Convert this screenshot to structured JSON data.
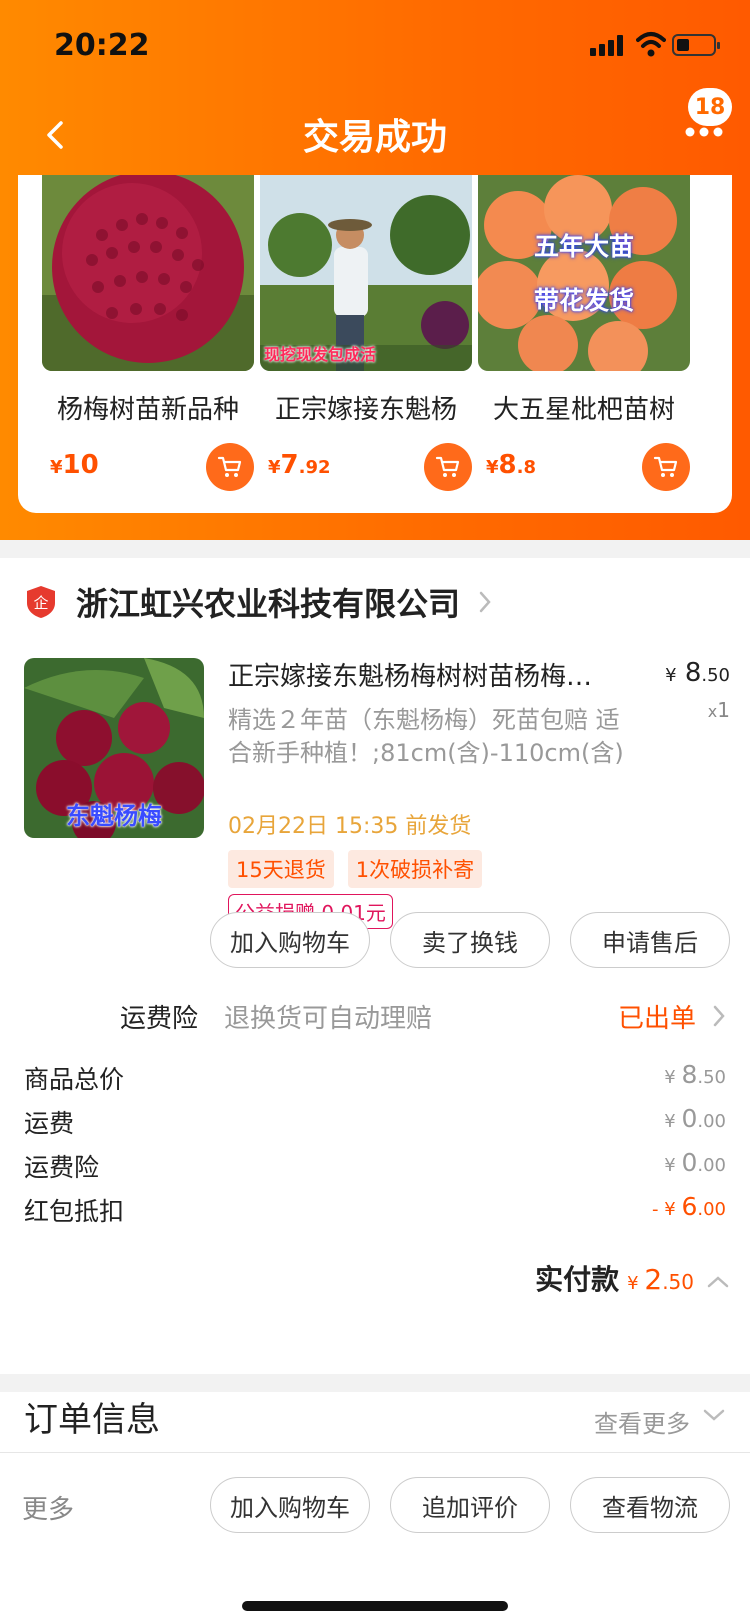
{
  "status_bar": {
    "time": "20:22"
  },
  "nav": {
    "title": "交易成功",
    "badge_count": "18"
  },
  "recommendations": [
    {
      "name": "杨梅树苗新品种",
      "yen": "¥",
      "price_int": "10",
      "price_dec": "",
      "image_caption": ""
    },
    {
      "name": "正宗嫁接东魁杨",
      "yen": "¥",
      "price_int": "7",
      "price_dec": ".92",
      "image_caption": "现挖现发包成活"
    },
    {
      "name": "大五星枇杷苗树",
      "yen": "¥",
      "price_int": "8",
      "price_dec": ".8",
      "image_caption_1": "五年大苗",
      "image_caption_2": "带花发货"
    }
  ],
  "shop": {
    "name": "浙江虹兴农业科技有限公司",
    "logo_text": "企"
  },
  "product": {
    "title": "正宗嫁接东魁杨梅树树苗杨梅…",
    "price_yen": "¥",
    "price_int": "8",
    "price_dec": ".50",
    "qty_x": "x",
    "qty": "1",
    "spec": "精选２年苗（东魁杨梅）死苗包赔 适合新手种植！;81cm(含)-110cm(含)",
    "ship_time": "02月22日 15:35 前发货",
    "tags": [
      "15天退货",
      "1次破损补寄"
    ],
    "charity": "公益捐赠 0.01元",
    "image_caption": "东魁杨梅"
  },
  "item_actions": [
    "加入购物车",
    "卖了换钱",
    "申请售后"
  ],
  "insurance": {
    "label": "运费险",
    "desc": "退换货可自动理赔",
    "status": "已出单"
  },
  "summary": [
    {
      "label": "商品总价",
      "yen": "¥ ",
      "int": "8",
      "dec": ".50",
      "prefix": ""
    },
    {
      "label": "运费",
      "yen": "¥ ",
      "int": "0",
      "dec": ".00",
      "prefix": ""
    },
    {
      "label": "运费险",
      "yen": "¥ ",
      "int": "0",
      "dec": ".00",
      "prefix": ""
    },
    {
      "label": "红包抵扣",
      "yen": "¥ ",
      "int": "6",
      "dec": ".00",
      "prefix": "- "
    }
  ],
  "paid": {
    "label": "实付款",
    "yen": "¥ ",
    "int": "2",
    "dec": ".50"
  },
  "order_info": {
    "title": "订单信息",
    "more": "查看更多"
  },
  "bottom_bar": {
    "more": "更多",
    "actions": [
      "加入购物车",
      "追加评价",
      "查看物流"
    ]
  },
  "colors": {
    "accent": "#ff5000",
    "header_start": "#ff8a00",
    "header_end": "#ff5a00",
    "ship_time": "#e8a53a",
    "charity": "#e0155c"
  }
}
